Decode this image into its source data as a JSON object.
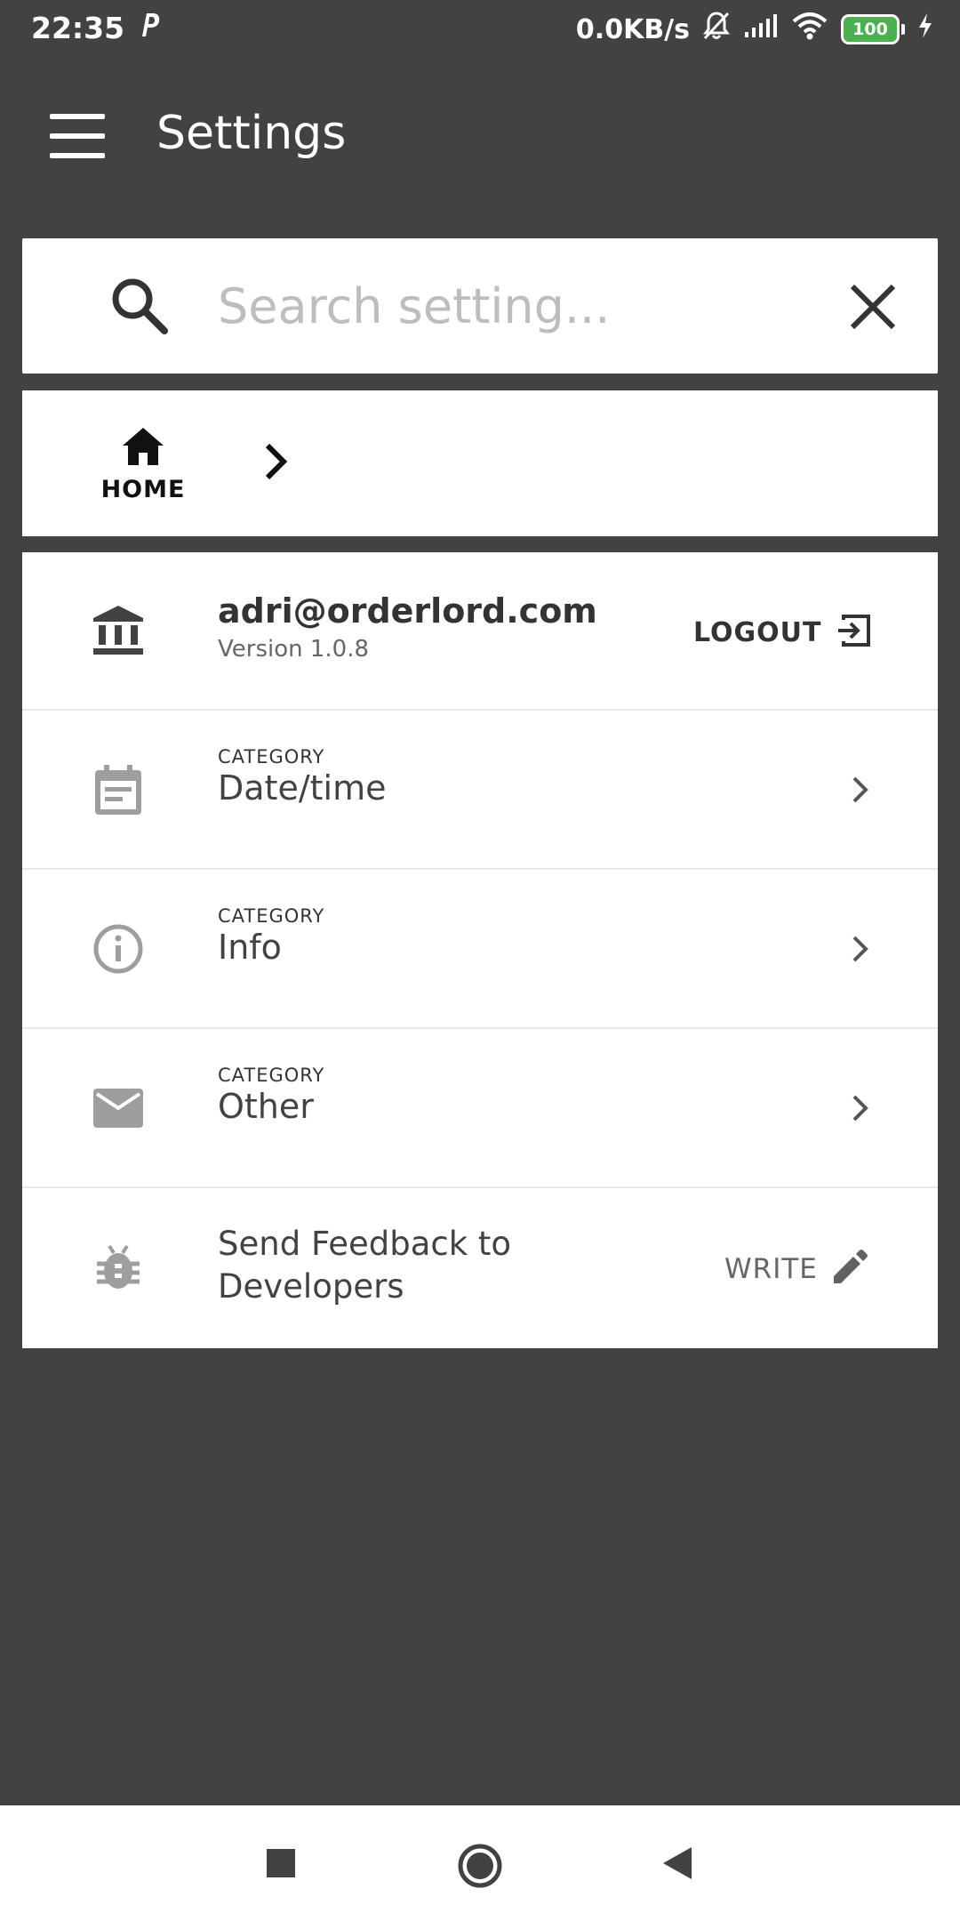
{
  "status_bar": {
    "time": "22:35",
    "network_speed": "0.0KB/s",
    "battery": "100",
    "icons": [
      "parking-icon",
      "bell-off-icon",
      "signal-icon",
      "wifi-icon",
      "battery-icon",
      "charging-icon"
    ]
  },
  "app_bar": {
    "title": "Settings"
  },
  "search": {
    "placeholder": "Search setting..."
  },
  "breadcrumb": {
    "home_label": "HOME"
  },
  "account": {
    "email": "adri@orderlord.com",
    "version": "Version 1.0.8",
    "logout_label": "LOGOUT"
  },
  "categories": [
    {
      "caption": "CATEGORY",
      "label": "Date/time",
      "icon": "calendar-icon"
    },
    {
      "caption": "CATEGORY",
      "label": "Info",
      "icon": "info-icon"
    },
    {
      "caption": "CATEGORY",
      "label": "Other",
      "icon": "mail-icon"
    }
  ],
  "feedback": {
    "title": "Send Feedback to Developers",
    "action_label": "WRITE"
  },
  "colors": {
    "background": "#424242",
    "card": "#ffffff",
    "icon_gray": "#9e9e9e",
    "battery_green": "#4caf50"
  }
}
